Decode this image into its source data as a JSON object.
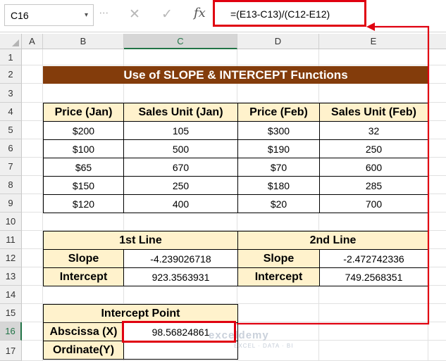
{
  "formula_bar": {
    "name_box": "C16",
    "name_box_arrow": "▾",
    "dots": "⋮",
    "cancel": "✕",
    "enter": "✓",
    "fx": "fx",
    "formula": "=(E13-C13)/(C12-E12)"
  },
  "columns": [
    "A",
    "B",
    "C",
    "D",
    "E"
  ],
  "rows": [
    "1",
    "2",
    "3",
    "4",
    "5",
    "6",
    "7",
    "8",
    "9",
    "10",
    "11",
    "12",
    "13",
    "14",
    "15",
    "16",
    "17"
  ],
  "title": "Use of SLOPE & INTERCEPT Functions",
  "table1": {
    "headers": [
      "Price (Jan)",
      "Sales Unit (Jan)",
      "Price (Feb)",
      "Sales Unit (Feb)"
    ],
    "rows": [
      [
        "$200",
        "105",
        "$300",
        "32"
      ],
      [
        "$100",
        "500",
        "$190",
        "250"
      ],
      [
        "$65",
        "670",
        "$70",
        "600"
      ],
      [
        "$150",
        "250",
        "$180",
        "285"
      ],
      [
        "$120",
        "400",
        "$20",
        "700"
      ]
    ]
  },
  "table2": {
    "line1": "1st Line",
    "line2": "2nd Line",
    "slope_label": "Slope",
    "intercept_label": "Intercept",
    "slope1": "-4.239026718",
    "intercept1": "923.3563931",
    "slope2": "-2.472742336",
    "intercept2": "749.2568351"
  },
  "table3": {
    "header": "Intercept Point",
    "abscissa_label": "Abscissa (X)",
    "abscissa_value": "98.56824861",
    "ordinate_label": "Ordinate(Y)",
    "ordinate_value": ""
  },
  "watermark": {
    "name": "exceldemy",
    "sub": "EXCEL · DATA · BI"
  },
  "colors": {
    "title_bg": "#833c0b",
    "header_bg": "#fff2cc",
    "highlight": "#e00010"
  }
}
